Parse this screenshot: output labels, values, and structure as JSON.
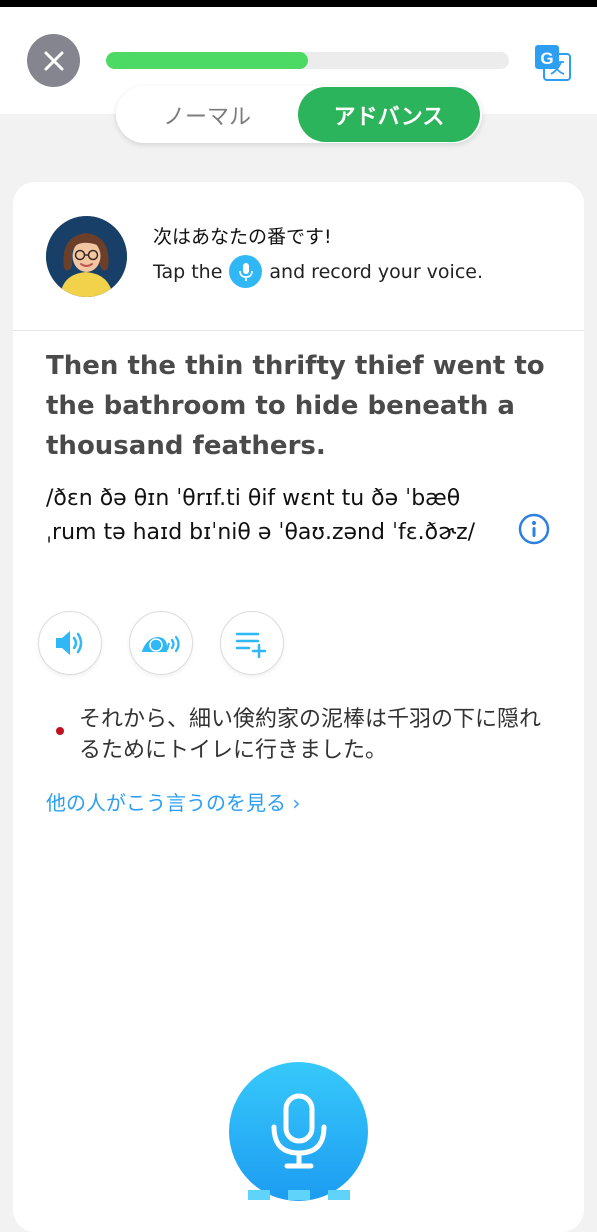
{
  "header": {
    "progress_fraction": 0.5,
    "close_icon": "close-icon",
    "translate_icon": "translate-icon"
  },
  "mode_toggle": {
    "normal_label": "ノーマル",
    "advance_label": "アドバンス",
    "selected": "advance"
  },
  "prompt": {
    "title": "次はあなたの番です!",
    "sub_before": "Tap the",
    "sub_after": "and record your voice."
  },
  "exercise": {
    "sentence": "Then the thin thrifty thief went to the bathroom to hide beneath a thousand feathers.",
    "ipa": "/ðɛn ðə θɪn ˈθrɪf.ti θif wɛnt tu ðə ˈbæθˌrum tə haɪd bɪˈniθ ə ˈθaʊ.zənd ˈfɛ.ðɚz/",
    "translation": "それから、細い倹約家の泥棒は千羽の下に隠れるためにトイレに行きました。",
    "see_others_link": "他の人がこう言うのを見る ›"
  },
  "actions": {
    "icons": [
      "speaker-icon",
      "slow-snail-icon",
      "add-to-list-icon"
    ]
  },
  "colors": {
    "accent_green": "#2cb45c",
    "progress_green": "#4cd964",
    "accent_blue": "#2d9ff3"
  }
}
